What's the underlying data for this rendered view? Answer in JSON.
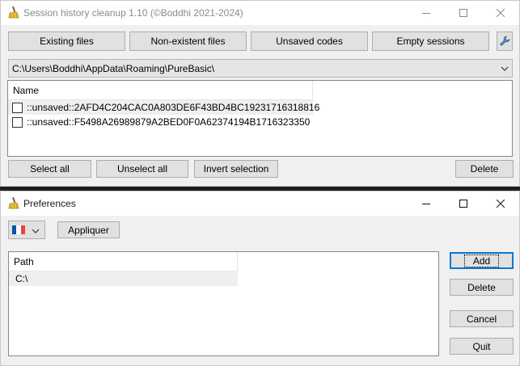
{
  "window1": {
    "title": "Session history cleanup 1.10 (©Boddhi 2021-2024)",
    "top_buttons": [
      {
        "label": "Existing files"
      },
      {
        "label": "Non-existent files"
      },
      {
        "label": "Unsaved codes"
      },
      {
        "label": "Empty sessions"
      }
    ],
    "settings_icon": "wrench-icon",
    "path_combo": {
      "value": "C:\\Users\\Boddhi\\AppData\\Roaming\\PureBasic\\"
    },
    "list": {
      "header": "Name",
      "rows": [
        {
          "label": "::unsaved::2AFD4C204CAC0A803DE6F43BD4BC19231716318816",
          "checked": false
        },
        {
          "label": "::unsaved::F5498A26989879A2BED0F0A62374194B1716323350",
          "checked": false
        }
      ]
    },
    "bottom_buttons": {
      "select_all": "Select all",
      "unselect_all": "Unselect all",
      "invert_selection": "Invert selection",
      "delete": "Delete"
    }
  },
  "window2": {
    "title": "Preferences",
    "language_flag": "flag-france-icon",
    "flag_colors": [
      "#0055a4",
      "#ffffff",
      "#ef4135"
    ],
    "apply_label": "Appliquer",
    "list": {
      "header": "Path",
      "rows": [
        {
          "label": "C:\\"
        }
      ]
    },
    "buttons": {
      "add": "Add",
      "delete": "Delete",
      "cancel": "Cancel",
      "quit": "Quit"
    }
  },
  "colors": {
    "accent": "#0078d7",
    "window_bg": "#f0f0f0",
    "button_bg": "#e1e1e1"
  }
}
